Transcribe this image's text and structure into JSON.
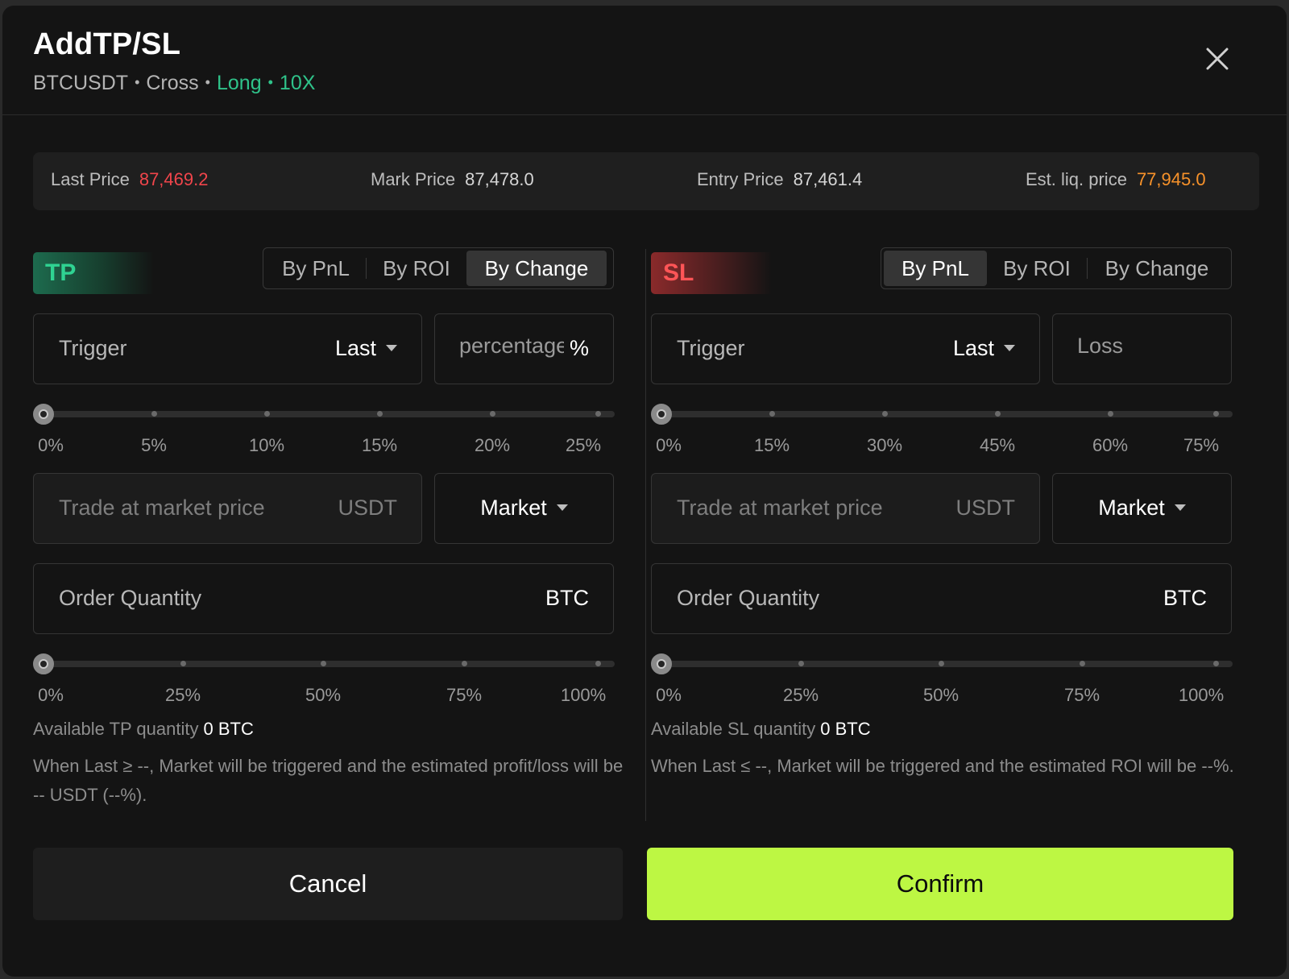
{
  "header": {
    "title": "AddTP/SL",
    "symbol": "BTCUSDT",
    "sep": "•",
    "margin_mode": "Cross",
    "side": "Long",
    "leverage": "10X"
  },
  "prices": {
    "last": {
      "label": "Last Price",
      "value": "87,469.2",
      "color": "#f0454b"
    },
    "mark": {
      "label": "Mark Price",
      "value": "87,478.0"
    },
    "entry": {
      "label": "Entry Price",
      "value": "87,461.4"
    },
    "liq": {
      "label": "Est. liq. price",
      "value": "77,945.0",
      "color": "#f7922a"
    }
  },
  "tp": {
    "badge": "TP",
    "tabs": [
      "By PnL",
      "By ROI",
      "By Change"
    ],
    "active_tab": "By Change",
    "trigger_label": "Trigger",
    "trigger_value": "Last",
    "value_placeholder": "percentage",
    "value_suffix": "%",
    "trigger_slider": {
      "labels": [
        "0%",
        "5%",
        "10%",
        "15%",
        "20%",
        "25%"
      ],
      "value": 0
    },
    "price_placeholder": "Trade at market price",
    "price_unit": "USDT",
    "order_type": "Market",
    "qty_label": "Order Quantity",
    "qty_unit": "BTC",
    "qty_slider": {
      "labels": [
        "0%",
        "25%",
        "50%",
        "75%",
        "100%"
      ],
      "value": 0
    },
    "avail_label": "Available TP quantity",
    "avail_value": "0 BTC",
    "note": "When Last ≥ --, Market will be triggered and the estimated profit/loss will be -- USDT (--%)."
  },
  "sl": {
    "badge": "SL",
    "tabs": [
      "By PnL",
      "By ROI",
      "By Change"
    ],
    "active_tab": "By PnL",
    "trigger_label": "Trigger",
    "trigger_value": "Last",
    "value_placeholder": "Loss",
    "trigger_slider": {
      "labels": [
        "0%",
        "15%",
        "30%",
        "45%",
        "60%",
        "75%"
      ],
      "value": 0
    },
    "price_placeholder": "Trade at market price",
    "price_unit": "USDT",
    "order_type": "Market",
    "qty_label": "Order Quantity",
    "qty_unit": "BTC",
    "qty_slider": {
      "labels": [
        "0%",
        "25%",
        "50%",
        "75%",
        "100%"
      ],
      "value": 0
    },
    "avail_label": "Available SL quantity",
    "avail_value": "0 BTC",
    "note": "When Last ≤ --, Market will be triggered and the estimated ROI will be --%."
  },
  "actions": {
    "cancel": "Cancel",
    "confirm": "Confirm"
  },
  "colors": {
    "accent_green": "#2fc38a",
    "confirm_bg": "#bdf743",
    "tp": "#2fd392",
    "sl": "#ff5557"
  }
}
